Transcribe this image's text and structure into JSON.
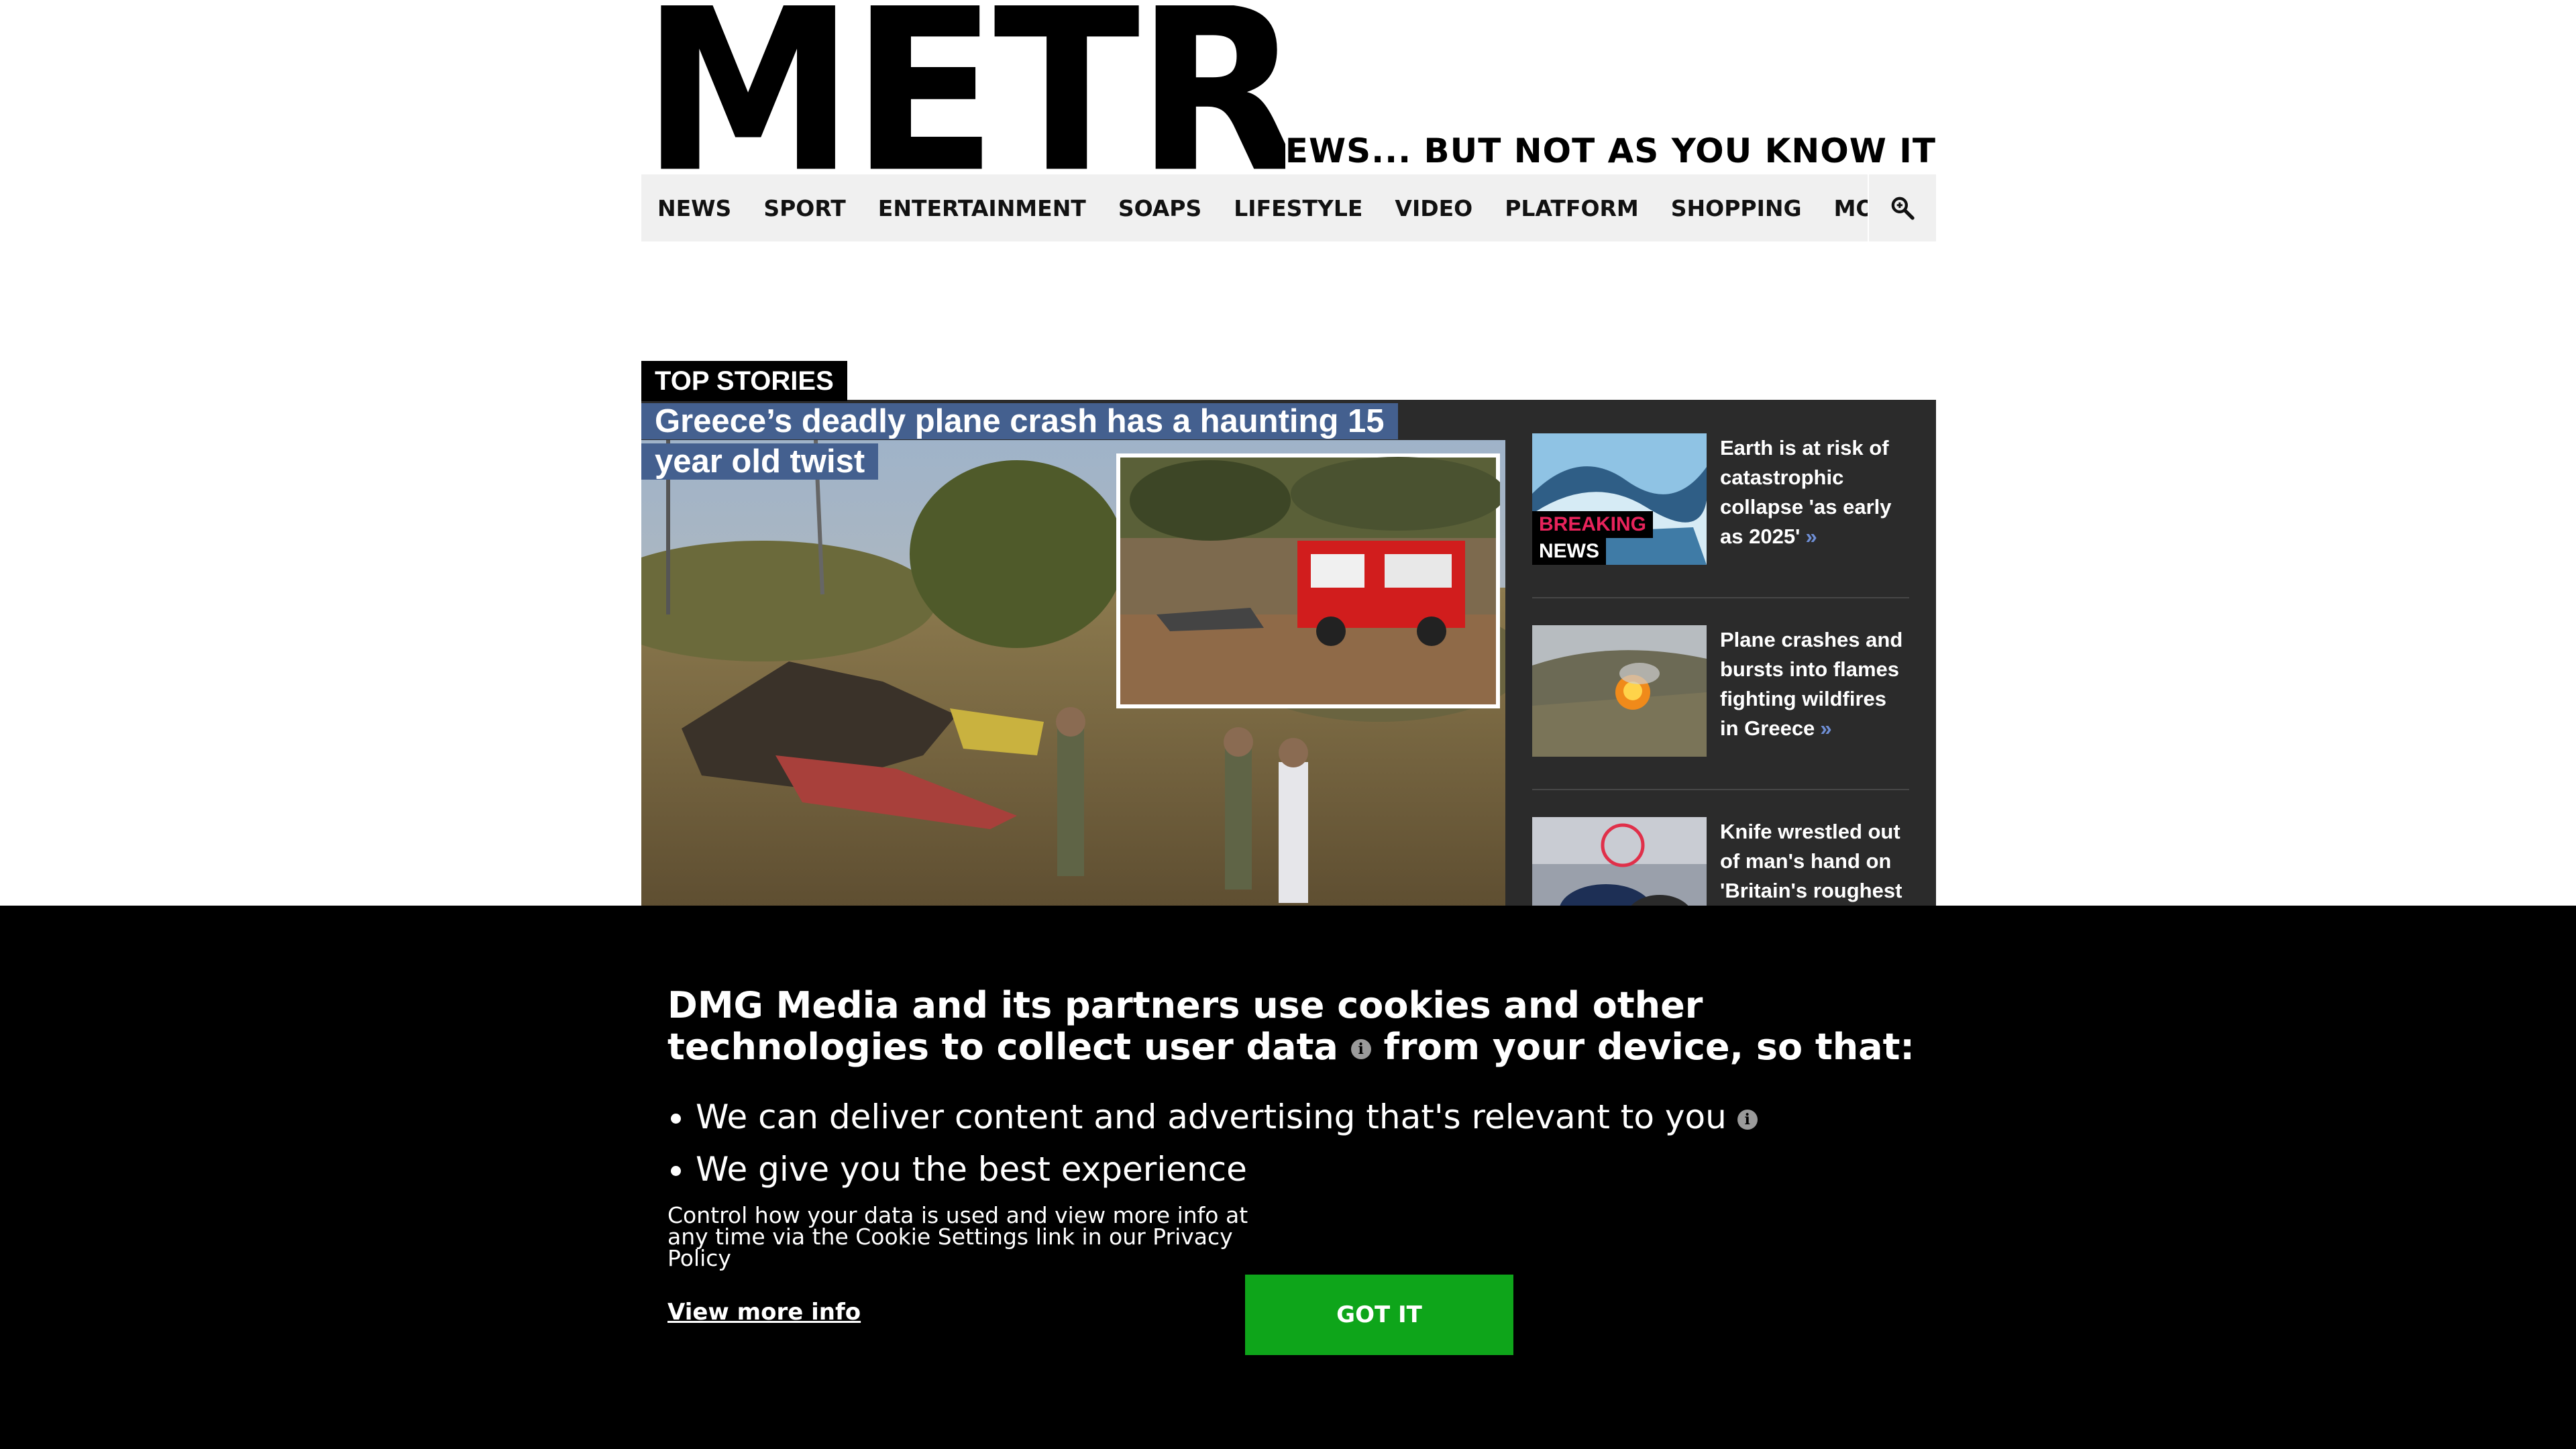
{
  "header": {
    "logo": "METRO",
    "tagline": "NEWS... BUT NOT AS YOU KNOW IT"
  },
  "nav": {
    "items": [
      "NEWS",
      "SPORT",
      "ENTERTAINMENT",
      "SOAPS",
      "LIFESTYLE",
      "VIDEO",
      "PLATFORM",
      "SHOPPING",
      "MORE"
    ],
    "search_icon": "search-icon"
  },
  "top_stories": {
    "label": "TOP STORIES",
    "hero": {
      "title": "Greece’s deadly plane crash has a haunting 15 year old twist"
    },
    "side": [
      {
        "title": "Earth is at risk of catastrophic collapse 'as early as 2025'",
        "arrow": "»",
        "badge_line1": "BREAKING",
        "badge_line2": "NEWS"
      },
      {
        "title": "Plane crashes and bursts into flames fighting wildfires in Greece",
        "arrow": "»"
      },
      {
        "title": "Knife wrestled out of man's hand on 'Britain's roughest",
        "arrow": ""
      }
    ]
  },
  "cookie": {
    "title_part1": "DMG Media and its partners use cookies and other technologies to collect user data",
    "title_part2": "from your device, so that:",
    "info_glyph": "i",
    "bullets": [
      "We can deliver content and advertising that's relevant to you",
      "We give you the best experience"
    ],
    "small_text": "Control how your data is used and view more info at any time via the Cookie Settings link in our Privacy Policy",
    "view_more": "View more info",
    "button": "GOT IT"
  },
  "colors": {
    "accent_blue": "#44608f",
    "breaking_red": "#e8235b",
    "button_green": "#0ea51a",
    "panel_dark": "#2b2b2b"
  }
}
